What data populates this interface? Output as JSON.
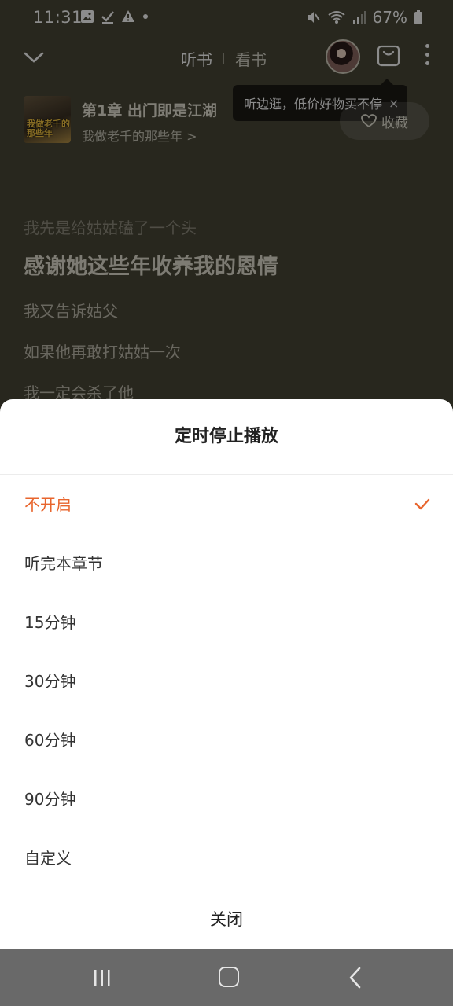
{
  "status_bar": {
    "time": "11:31",
    "battery": "67%",
    "left_icons": [
      "gallery-icon",
      "check-icon",
      "warning-icon",
      "dot-icon"
    ],
    "right_icons": [
      "mute-icon",
      "wifi-icon",
      "signal-icon",
      "battery-icon"
    ]
  },
  "header": {
    "tabs": [
      {
        "label": "听书",
        "active": true
      },
      {
        "label": "看书",
        "active": false
      }
    ]
  },
  "tooltip": {
    "text": "听边逛，低价好物买不停",
    "close": "×"
  },
  "book": {
    "cover_text": "我做老千的那些年",
    "chapter_title": "第1章 出门即是江湖",
    "book_name": "我做老千的那些年 >",
    "favorite_label": "收藏"
  },
  "lyrics": {
    "faded": "我先是给姑姑磕了一个头",
    "current": "感谢她这些年收养我的恩情",
    "next": [
      "我又告诉姑父",
      "如果他再敢打姑姑一次",
      "我一定会杀了他"
    ]
  },
  "sheet": {
    "title": "定时停止播放",
    "options": [
      {
        "label": "不开启",
        "selected": true
      },
      {
        "label": "听完本章节",
        "selected": false
      },
      {
        "label": "15分钟",
        "selected": false
      },
      {
        "label": "30分钟",
        "selected": false
      },
      {
        "label": "60分钟",
        "selected": false
      },
      {
        "label": "90分钟",
        "selected": false
      },
      {
        "label": "自定义",
        "selected": false
      }
    ],
    "close_label": "关闭"
  },
  "colors": {
    "accent": "#e8652d",
    "sheet_bg": "#ffffff",
    "nav_bg": "#696969"
  }
}
